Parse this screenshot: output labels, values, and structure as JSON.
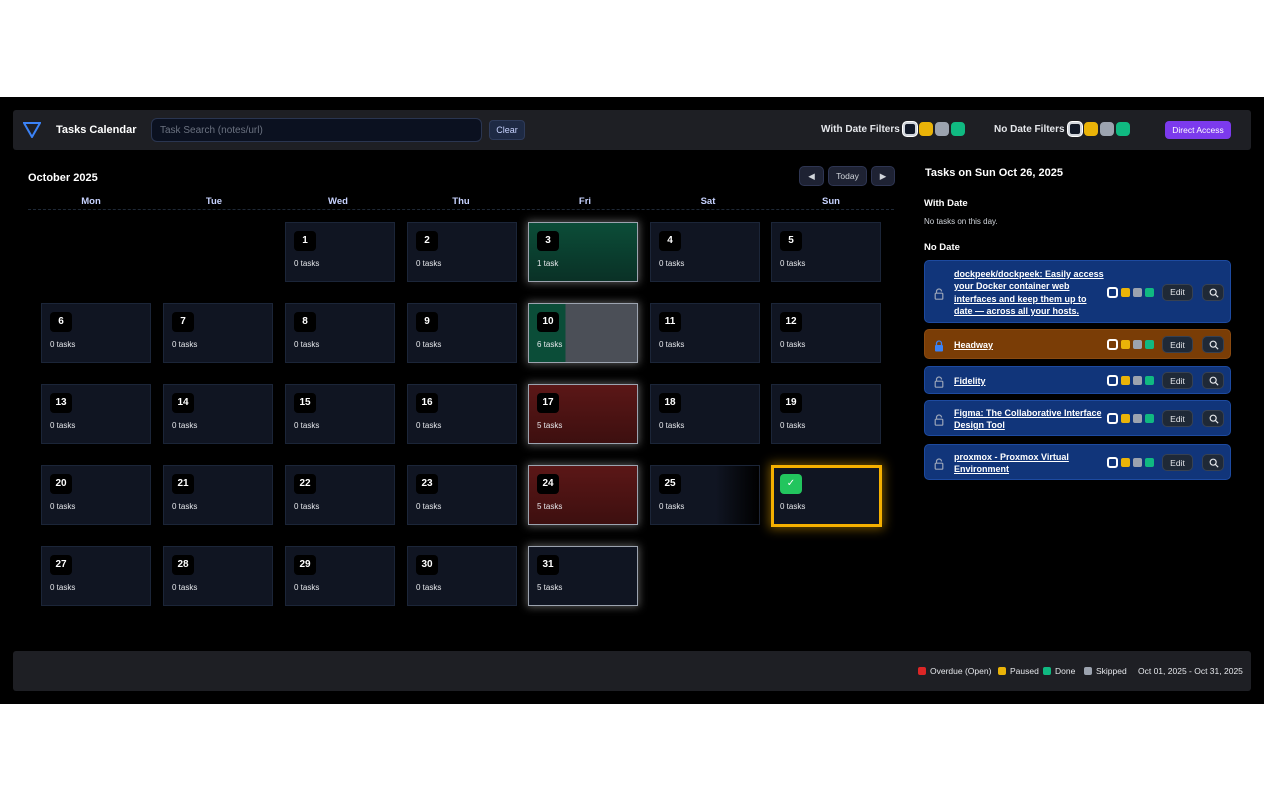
{
  "header": {
    "title": "Tasks Calendar",
    "search_placeholder": "Task Search (notes/url)",
    "clear_label": "Clear",
    "with_date_filters_label": "With Date Filters",
    "no_date_filters_label": "No Date Filters",
    "direct_access_label": "Direct Access",
    "filter_colors": [
      "clear",
      "#eab308",
      "#9ca3af",
      "#10b981"
    ]
  },
  "calendar": {
    "month_label": "October 2025",
    "prev_label": "◀",
    "today_label": "Today",
    "next_label": "▶",
    "weekdays": [
      "Mon",
      "Tue",
      "Wed",
      "Thu",
      "Fri",
      "Sat",
      "Sun"
    ],
    "days": [
      {
        "day": "1",
        "tasks": "0 tasks"
      },
      {
        "day": "2",
        "tasks": "0 tasks"
      },
      {
        "day": "3",
        "tasks": "1 task",
        "status": "done"
      },
      {
        "day": "4",
        "tasks": "0 tasks"
      },
      {
        "day": "5",
        "tasks": "0 tasks"
      },
      {
        "day": "6",
        "tasks": "0 tasks"
      },
      {
        "day": "7",
        "tasks": "0 tasks"
      },
      {
        "day": "8",
        "tasks": "0 tasks"
      },
      {
        "day": "9",
        "tasks": "0 tasks"
      },
      {
        "day": "10",
        "tasks": "6 tasks",
        "status": "mixed"
      },
      {
        "day": "11",
        "tasks": "0 tasks"
      },
      {
        "day": "12",
        "tasks": "0 tasks"
      },
      {
        "day": "13",
        "tasks": "0 tasks"
      },
      {
        "day": "14",
        "tasks": "0 tasks"
      },
      {
        "day": "15",
        "tasks": "0 tasks"
      },
      {
        "day": "16",
        "tasks": "0 tasks"
      },
      {
        "day": "17",
        "tasks": "5 tasks",
        "status": "overdue"
      },
      {
        "day": "18",
        "tasks": "0 tasks"
      },
      {
        "day": "19",
        "tasks": "0 tasks"
      },
      {
        "day": "20",
        "tasks": "0 tasks"
      },
      {
        "day": "21",
        "tasks": "0 tasks"
      },
      {
        "day": "22",
        "tasks": "0 tasks"
      },
      {
        "day": "23",
        "tasks": "0 tasks"
      },
      {
        "day": "24",
        "tasks": "5 tasks",
        "status": "overdue"
      },
      {
        "day": "25",
        "tasks": "0 tasks",
        "status": "fade"
      },
      {
        "day": "✓",
        "tasks": "0 tasks",
        "status": "today"
      },
      {
        "day": "27",
        "tasks": "0 tasks"
      },
      {
        "day": "28",
        "tasks": "0 tasks"
      },
      {
        "day": "29",
        "tasks": "0 tasks"
      },
      {
        "day": "30",
        "tasks": "0 tasks"
      },
      {
        "day": "31",
        "tasks": "5 tasks",
        "status": "glow"
      }
    ]
  },
  "panel": {
    "title": "Tasks on Sun Oct 26, 2025",
    "with_date_heading": "With Date",
    "with_date_empty": "No tasks on this day.",
    "no_date_heading": "No Date",
    "edit_label": "Edit",
    "tasks": [
      {
        "title": "dockpeek/dockpeek: Easily access your Docker container web interfaces and keep them up to date — across all your hosts.",
        "status": "open",
        "icon": "lock-open-icon"
      },
      {
        "title": "Headway",
        "status": "paused",
        "icon": "lock-closed-icon"
      },
      {
        "title": "Fidelity",
        "status": "open",
        "icon": "lock-open-icon"
      },
      {
        "title": "Figma: The Collaborative Interface Design Tool",
        "status": "open",
        "icon": "lock-open-icon"
      },
      {
        "title": "proxmox - Proxmox Virtual Environment",
        "status": "open",
        "icon": "lock-open-icon"
      }
    ]
  },
  "footer": {
    "legend": [
      {
        "label": "Overdue (Open)",
        "color": "#dc2626"
      },
      {
        "label": "Paused",
        "color": "#eab308"
      },
      {
        "label": "Done",
        "color": "#10b981"
      },
      {
        "label": "Skipped",
        "color": "#9ca3af"
      }
    ],
    "range": "Oct 01, 2025 - Oct 31, 2025"
  }
}
